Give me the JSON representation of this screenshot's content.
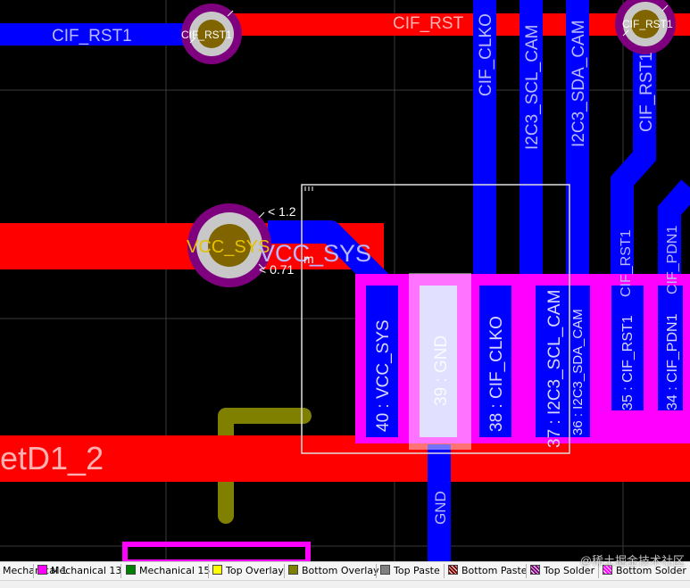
{
  "colors": {
    "top_copper": "#ff0000",
    "bottom_copper": "#0000ff",
    "mechanical_13": "#ff00ff",
    "mechanical_15": "#008000",
    "top_overlay": "#ffff00",
    "bottom_overlay": "#808000",
    "top_paste": "#808080",
    "pad_highlight": "#c8c8c8",
    "via_ring": "#7f007f",
    "via_hole": "#806400"
  },
  "board": {
    "net_labels": {
      "cif_rst1_left": "CIF_RST1",
      "cif_rst1_via_left": "CIF_RST1",
      "cif_rst_top": "CIF_RST",
      "cif_rst1_via_right": "CIF_RST1",
      "cif_rst1_vertical": "CIF_RST1",
      "cif_clko_vertical": "CIF_CLKO",
      "i2c3_scl_vertical": "I2C3_SCL_CAM",
      "i2c3_sda_vertical": "I2C3_SDA_CAM",
      "cif_rst1_lower": "CIF_RST1",
      "cif_pdn1_lower": "CIF_PDN1",
      "vcc_sys_via": "VCC_SYS",
      "vcc_sys_trace": "VCC_SYS",
      "netd1_2": "etD1_2",
      "gnd_bottom": "GND"
    },
    "pad_labels": {
      "pad40": "40 : VCC_SYS",
      "pad39": "39 : GND",
      "pad38": "38 : CIF_CLKO",
      "pad37": "37 : I2C3_SCL_CAM",
      "pad36": "36 : I2C3_SDA_CAM",
      "pad35": "35 : CIF_RST1",
      "pad34": "34 : CIF_PDN1"
    },
    "dimensions": {
      "upper": "< 1.2",
      "lower": "< 0.71",
      "upper_unit": "m",
      "lower_unit": "m"
    }
  },
  "layer_tabs": [
    {
      "label": "Mechanical 1",
      "color": "#ff00ff",
      "icon": "solid-swatch"
    },
    {
      "label": "Mechanical 13",
      "color": "#ff00ff",
      "icon": "solid-swatch"
    },
    {
      "label": "Mechanical 15",
      "color": "#008000",
      "icon": "solid-swatch"
    },
    {
      "label": "Top Overlay",
      "color": "#ffff00",
      "icon": "solid-swatch"
    },
    {
      "label": "Bottom Overlay",
      "color": "#808000",
      "icon": "solid-swatch"
    },
    {
      "label": "Top Paste",
      "color": "#808080",
      "icon": "solid-swatch"
    },
    {
      "label": "Bottom Paste",
      "color": "#800000",
      "icon": "hatched-swatch"
    },
    {
      "label": "Top Solder",
      "color": "#800080",
      "icon": "hatched-swatch"
    },
    {
      "label": "Bottom Solder",
      "color": "#ff00ff",
      "icon": "hatched-swatch"
    }
  ],
  "watermark": "@稀土掘金技术社区"
}
